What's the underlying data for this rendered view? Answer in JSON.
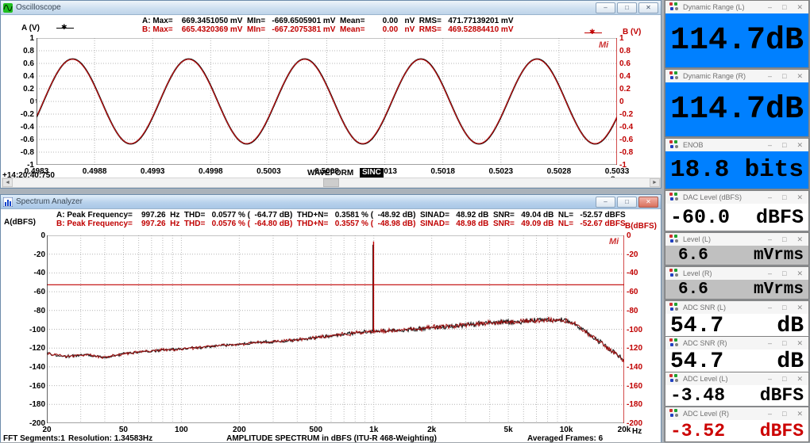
{
  "chrome": {
    "minimize_glyph": "–",
    "maximize_glyph": "□",
    "close_glyph": "✕",
    "scroll_left_glyph": "◄",
    "scroll_right_glyph": "►"
  },
  "oscilloscope": {
    "title": "Oscilloscope",
    "stats_a": "A: Max=    669.3451050 mV  MIn=   -669.6505901 mV  Mean=        0.00   nV  RMS=   471.77139201 mV",
    "stats_b": "B: Max=    665.4320369 mV  MIn=   -667.2075381 mV  Mean=        0.00   nV  RMS=   469.52884410 mV",
    "left_axis_label": "A (V)",
    "right_axis_label": "B (V)",
    "trigger_time": "+14:20:40:750",
    "bottom_label": "WAVEFORM",
    "mode_badge": "SINC",
    "x_unit": "s",
    "watermark": "Mi"
  },
  "spectrum": {
    "title": "Spectrum Analyzer",
    "stats_a": "A: Peak Frequency=    997.26  Hz  THD=   0.0577 % (  -64.77 dB)  THD+N=   0.3581 % (  -48.92 dB)  SINAD=   48.92 dB  SNR=   49.04 dB  NL=   -52.57 dBFS",
    "stats_b": "B: Peak Frequency=    997.26  Hz  THD=   0.0576 % (  -64.80 dB)  THD+N=   0.3557 % (  -48.98 dB)  SINAD=   48.98 dB  SNR=   49.09 dB  NL=   -52.67 dBFS",
    "left_axis_label": "A(dBFS)",
    "right_axis_label": "B(dBFS)",
    "fft_segments": "FFT Segments:1",
    "resolution": "Resolution: 1.34583Hz",
    "center_title": "AMPLITUDE SPECTRUM in dBFS (ITU-R 468-Weighting)",
    "averaged": "Averaged Frames: 6",
    "x_unit": "Hz",
    "watermark": "Mi"
  },
  "meters": [
    {
      "title": "Dynamic Range (L)",
      "num": "114.7",
      "unit": "dB",
      "bg": "#0080ff",
      "fg": "#000000"
    },
    {
      "title": "Dynamic Range (R)",
      "num": "114.7",
      "unit": "dB",
      "bg": "#0080ff",
      "fg": "#000000"
    },
    {
      "title": "ENOB",
      "num": "18.8",
      "unit": "bits",
      "bg": "#0080ff",
      "fg": "#000000"
    },
    {
      "title": "DAC Level (dBFS)",
      "num": "-60.0",
      "unit": "dBFS",
      "bg": "#ffffff",
      "fg": "#000000"
    },
    {
      "title": "Level (L)",
      "num": "6.6",
      "unit": "mVrms",
      "bg": "#c0c0c0",
      "fg": "#000000"
    },
    {
      "title": "Level (R)",
      "num": "6.6",
      "unit": "mVrms",
      "bg": "#c0c0c0",
      "fg": "#000000"
    },
    {
      "title": "ADC SNR (L)",
      "num": "54.7",
      "unit": "dB",
      "bg": "#ffffff",
      "fg": "#000000"
    },
    {
      "title": "ADC SNR (R)",
      "num": "54.7",
      "unit": "dB",
      "bg": "#ffffff",
      "fg": "#000000"
    },
    {
      "title": "ADC Level (L)",
      "num": "-3.48",
      "unit": "dBFS",
      "bg": "#ffffff",
      "fg": "#000000"
    },
    {
      "title": "ADC Level (R)",
      "num": "-3.52",
      "unit": "dBFS",
      "bg": "#ffffff",
      "fg": "#cc0000"
    }
  ],
  "chart_data": [
    {
      "id": "oscilloscope-waveform",
      "type": "line",
      "title": "WAVEFORM",
      "x_range_s": [
        0.4983,
        0.5033
      ],
      "x_ticks": [
        "0.4983",
        "0.4988",
        "0.4993",
        "0.4998",
        "0.5003",
        "0.5008",
        "0.5013",
        "0.5018",
        "0.5023",
        "0.5028",
        "0.5033"
      ],
      "x_unit": "s",
      "ylim": [
        -1,
        1
      ],
      "y_ticks": [
        "1",
        "0.8",
        "0.6",
        "0.4",
        "0.2",
        "0",
        "-0.2",
        "-0.4",
        "-0.6",
        "-0.8",
        "-1"
      ],
      "grid": true,
      "series": [
        {
          "name": "A",
          "color": "#000000",
          "shape": "sine",
          "amplitude_v": 0.6693,
          "frequency_hz": 1000,
          "phase_rad": -0.38
        },
        {
          "name": "B",
          "color": "#cc1111",
          "shape": "sine",
          "amplitude_v": 0.6654,
          "frequency_hz": 1000,
          "phase_rad": -0.372
        }
      ]
    },
    {
      "id": "spectrum-amplitude",
      "type": "line",
      "title": "AMPLITUDE SPECTRUM in dBFS (ITU-R 468-Weighting)",
      "x_scale": "log",
      "x_range_hz": [
        20,
        20000
      ],
      "x_ticks": [
        "20",
        "50",
        "100",
        "200",
        "500",
        "1k",
        "2k",
        "5k",
        "10k",
        "20k"
      ],
      "x_tick_hz": [
        20,
        50,
        100,
        200,
        500,
        1000,
        2000,
        5000,
        10000,
        20000
      ],
      "x_unit": "Hz",
      "ylim": [
        -200,
        0
      ],
      "y_ticks": [
        "0",
        "-20",
        "-40",
        "-60",
        "-80",
        "-100",
        "-120",
        "-140",
        "-160",
        "-180",
        "-200"
      ],
      "grid": true,
      "peak": {
        "frequency_hz": 997.26,
        "level_dbfs": -6.5
      },
      "marker_line_dbfs": -52.6,
      "noise_floor_db": [
        [
          20,
          -126
        ],
        [
          25,
          -129
        ],
        [
          32,
          -127
        ],
        [
          40,
          -130
        ],
        [
          50,
          -126
        ],
        [
          63,
          -124
        ],
        [
          80,
          -122
        ],
        [
          100,
          -121
        ],
        [
          130,
          -119
        ],
        [
          160,
          -117
        ],
        [
          200,
          -116
        ],
        [
          250,
          -114
        ],
        [
          320,
          -113
        ],
        [
          400,
          -111
        ],
        [
          500,
          -109
        ],
        [
          650,
          -106
        ],
        [
          800,
          -104
        ],
        [
          1000,
          -102
        ],
        [
          1300,
          -101
        ],
        [
          1600,
          -100
        ],
        [
          2000,
          -98
        ],
        [
          2500,
          -97
        ],
        [
          3200,
          -95
        ],
        [
          4000,
          -93
        ],
        [
          5000,
          -92
        ],
        [
          6300,
          -91
        ],
        [
          8000,
          -90
        ],
        [
          9500,
          -90
        ],
        [
          10500,
          -92
        ],
        [
          12000,
          -99
        ],
        [
          13500,
          -107
        ],
        [
          15000,
          -114
        ],
        [
          17000,
          -122
        ],
        [
          18500,
          -128
        ],
        [
          20000,
          -134
        ]
      ],
      "series": [
        {
          "name": "A",
          "color": "#111111"
        },
        {
          "name": "B",
          "color": "#a01010"
        }
      ]
    }
  ]
}
